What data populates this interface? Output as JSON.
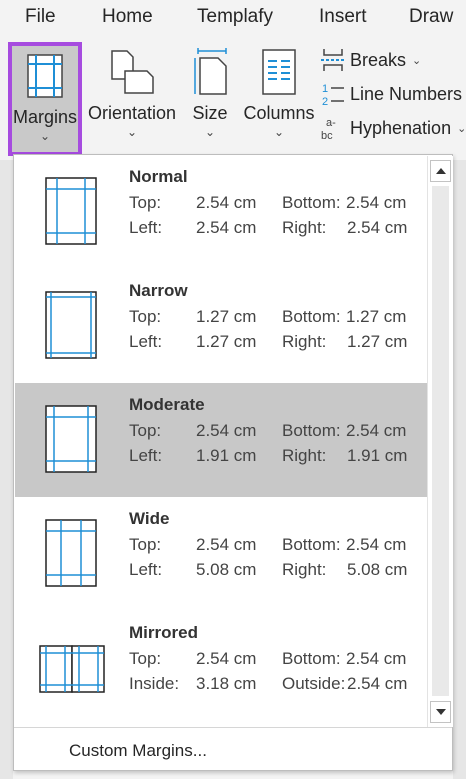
{
  "menu": {
    "tabs": [
      "File",
      "Home",
      "Templafy",
      "Insert",
      "Draw"
    ]
  },
  "ribbon": {
    "margins_label": "Margins",
    "orientation_label": "Orientation",
    "size_label": "Size",
    "columns_label": "Columns",
    "breaks_label": "Breaks",
    "line_numbers_label": "Line Numbers",
    "hyphenation_label": "Hyphenation",
    "chevron": "⌄"
  },
  "margins": {
    "presets": [
      {
        "name": "Normal",
        "top_label": "Top:",
        "top": "2.54 cm",
        "bottom_label": "Bottom:",
        "bottom": "2.54 cm",
        "left_label": "Left:",
        "left": "2.54 cm",
        "right_label": "Right:",
        "right": "2.54 cm"
      },
      {
        "name": "Narrow",
        "top_label": "Top:",
        "top": "1.27 cm",
        "bottom_label": "Bottom:",
        "bottom": "1.27 cm",
        "left_label": "Left:",
        "left": "1.27 cm",
        "right_label": "Right:",
        "right": "1.27 cm"
      },
      {
        "name": "Moderate",
        "top_label": "Top:",
        "top": "2.54 cm",
        "bottom_label": "Bottom:",
        "bottom": "2.54 cm",
        "left_label": "Left:",
        "left": "1.91 cm",
        "right_label": "Right:",
        "right": "1.91 cm"
      },
      {
        "name": "Wide",
        "top_label": "Top:",
        "top": "2.54 cm",
        "bottom_label": "Bottom:",
        "bottom": "2.54 cm",
        "left_label": "Left:",
        "left": "5.08 cm",
        "right_label": "Right:",
        "right": "5.08 cm"
      },
      {
        "name": "Mirrored",
        "top_label": "Top:",
        "top": "2.54 cm",
        "bottom_label": "Bottom:",
        "bottom": "2.54 cm",
        "left_label": "Inside:",
        "left": "3.18 cm",
        "right_label": "Outside:",
        "right": "2.54 cm"
      }
    ],
    "custom_label": "Custom Margins..."
  },
  "colors": {
    "accent": "#a64bdf",
    "guide": "#1f8fd6",
    "highlight": "#c8c8c8"
  },
  "icons": [
    "margins-icon",
    "orientation-icon",
    "size-icon",
    "columns-icon",
    "breaks-icon",
    "line-numbers-icon",
    "hyphenation-icon",
    "scroll-up-icon",
    "scroll-down-icon"
  ]
}
